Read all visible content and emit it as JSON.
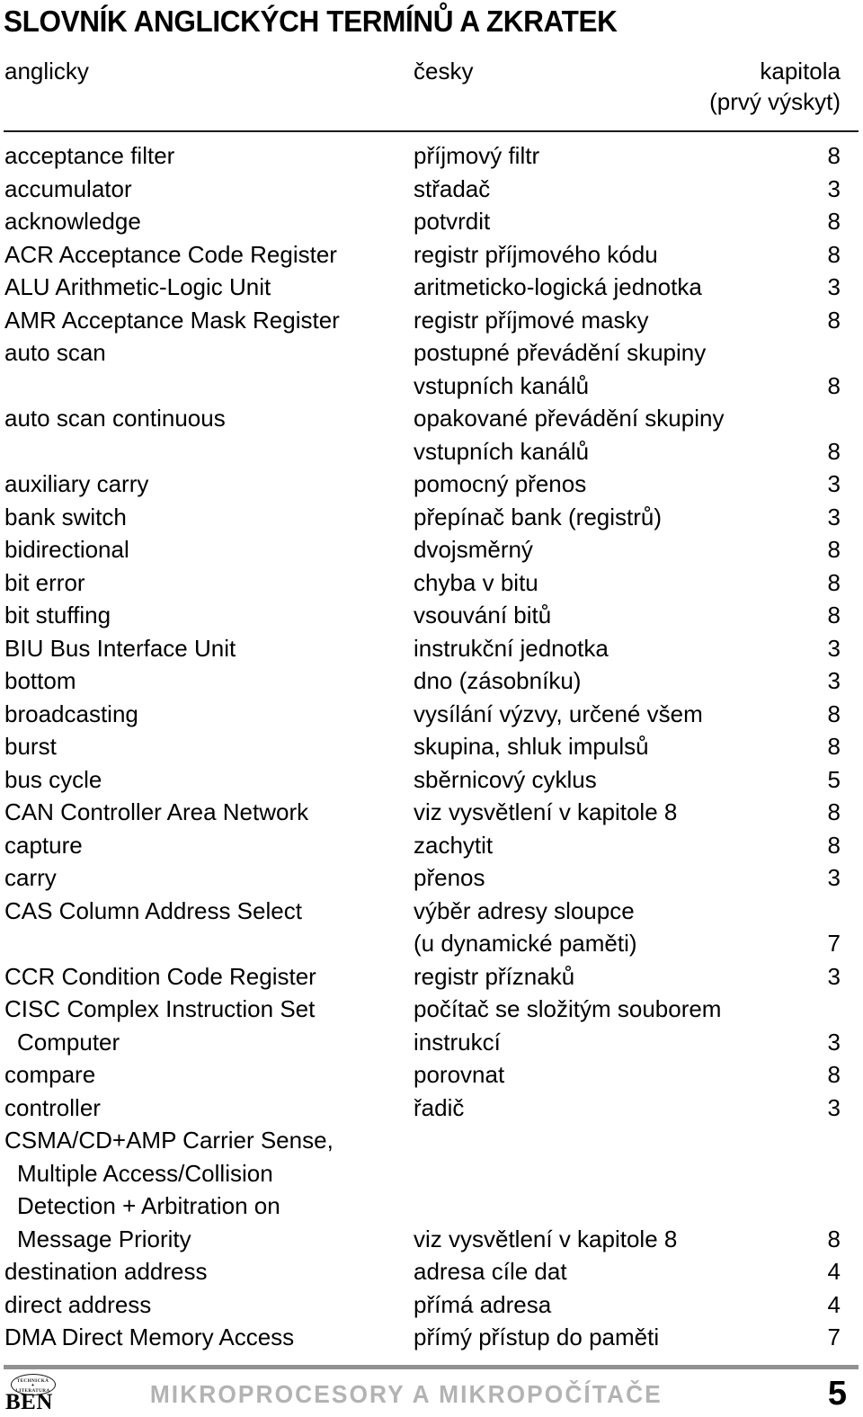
{
  "document": {
    "title": "SLOVNÍK ANGLICKÝCH TERMÍNŮ A ZKRATEK"
  },
  "columns": {
    "english": "anglicky",
    "czech": "česky",
    "chapter": "kapitola",
    "chapter_sub": "(prvý výskyt)"
  },
  "entries": [
    {
      "en": "acceptance filter",
      "cs": "příjmový filtr",
      "ch": "8",
      "indent": false
    },
    {
      "en": "accumulator",
      "cs": "střadač",
      "ch": "3",
      "indent": false
    },
    {
      "en": "acknowledge",
      "cs": "potvrdit",
      "ch": "8",
      "indent": false
    },
    {
      "en": "ACR Acceptance Code Register",
      "cs": "registr příjmového kódu",
      "ch": "8",
      "indent": false
    },
    {
      "en": "ALU Arithmetic-Logic Unit",
      "cs": "aritmeticko-logická jednotka",
      "ch": "3",
      "indent": false
    },
    {
      "en": "AMR Acceptance Mask Register",
      "cs": "registr příjmové masky",
      "ch": "8",
      "indent": false
    },
    {
      "en": "auto scan",
      "cs": "postupné převádění skupiny",
      "ch": "",
      "indent": false
    },
    {
      "en": "",
      "cs": "vstupních kanálů",
      "ch": "8",
      "indent": false
    },
    {
      "en": "auto scan continuous",
      "cs": "opakované převádění skupiny",
      "ch": "",
      "indent": false
    },
    {
      "en": "",
      "cs": "vstupních kanálů",
      "ch": "8",
      "indent": false
    },
    {
      "en": "auxiliary carry",
      "cs": "pomocný přenos",
      "ch": "3",
      "indent": false
    },
    {
      "en": "bank switch",
      "cs": "přepínač bank (registrů)",
      "ch": "3",
      "indent": false
    },
    {
      "en": "bidirectional",
      "cs": "dvojsměrný",
      "ch": "8",
      "indent": false
    },
    {
      "en": "bit error",
      "cs": "chyba v bitu",
      "ch": "8",
      "indent": false
    },
    {
      "en": "bit stuffing",
      "cs": "vsouvání bitů",
      "ch": "8",
      "indent": false
    },
    {
      "en": "BIU Bus Interface Unit",
      "cs": "instrukční jednotka",
      "ch": "3",
      "indent": false
    },
    {
      "en": "bottom",
      "cs": "dno (zásobníku)",
      "ch": "3",
      "indent": false
    },
    {
      "en": "broadcasting",
      "cs": "vysílání výzvy, určené všem",
      "ch": "8",
      "indent": false
    },
    {
      "en": "burst",
      "cs": "skupina, shluk impulsů",
      "ch": "8",
      "indent": false
    },
    {
      "en": "bus cycle",
      "cs": "sběrnicový cyklus",
      "ch": "5",
      "indent": false
    },
    {
      "en": "CAN Controller Area Network",
      "cs": "viz vysvětlení v kapitole 8",
      "ch": "8",
      "indent": false
    },
    {
      "en": "capture",
      "cs": "zachytit",
      "ch": "8",
      "indent": false
    },
    {
      "en": "carry",
      "cs": "přenos",
      "ch": "3",
      "indent": false
    },
    {
      "en": "CAS Column Address Select",
      "cs": "výběr adresy sloupce",
      "ch": "",
      "indent": false
    },
    {
      "en": "",
      "cs": "(u dynamické paměti)",
      "ch": "7",
      "indent": false
    },
    {
      "en": "CCR Condition Code Register",
      "cs": "registr příznaků",
      "ch": "3",
      "indent": false
    },
    {
      "en": "CISC Complex Instruction Set",
      "cs": "počítač se složitým souborem",
      "ch": "",
      "indent": false
    },
    {
      "en": "Computer",
      "cs": "instrukcí",
      "ch": "3",
      "indent": true
    },
    {
      "en": "compare",
      "cs": "porovnat",
      "ch": "8",
      "indent": false
    },
    {
      "en": "controller",
      "cs": "řadič",
      "ch": "3",
      "indent": false
    },
    {
      "en": "CSMA/CD+AMP Carrier Sense,",
      "cs": "",
      "ch": "",
      "indent": false
    },
    {
      "en": "Multiple Access/Collision",
      "cs": "",
      "ch": "",
      "indent": true
    },
    {
      "en": "Detection + Arbitration on",
      "cs": "",
      "ch": "",
      "indent": true
    },
    {
      "en": "Message Priority",
      "cs": "viz vysvětlení v kapitole 8",
      "ch": "8",
      "indent": true
    },
    {
      "en": "destination address",
      "cs": "adresa cíle dat",
      "ch": "4",
      "indent": false
    },
    {
      "en": "direct address",
      "cs": "přímá adresa",
      "ch": "4",
      "indent": false
    },
    {
      "en": "DMA Direct Memory Access",
      "cs": "přímý přístup do paměti",
      "ch": "7",
      "indent": false
    }
  ],
  "footer": {
    "logo_word": "BEN",
    "logo_line1": "TECHNICKÁ",
    "logo_line2": "LITERATURA",
    "book_title": "MIKROPROCESORY A MIKROPOČÍTAČE",
    "page_number": "5"
  },
  "colors": {
    "text": "#000000",
    "rule": "#1a1a1a",
    "footer_rule": "#919191",
    "footer_title": "#b3b3b3"
  }
}
